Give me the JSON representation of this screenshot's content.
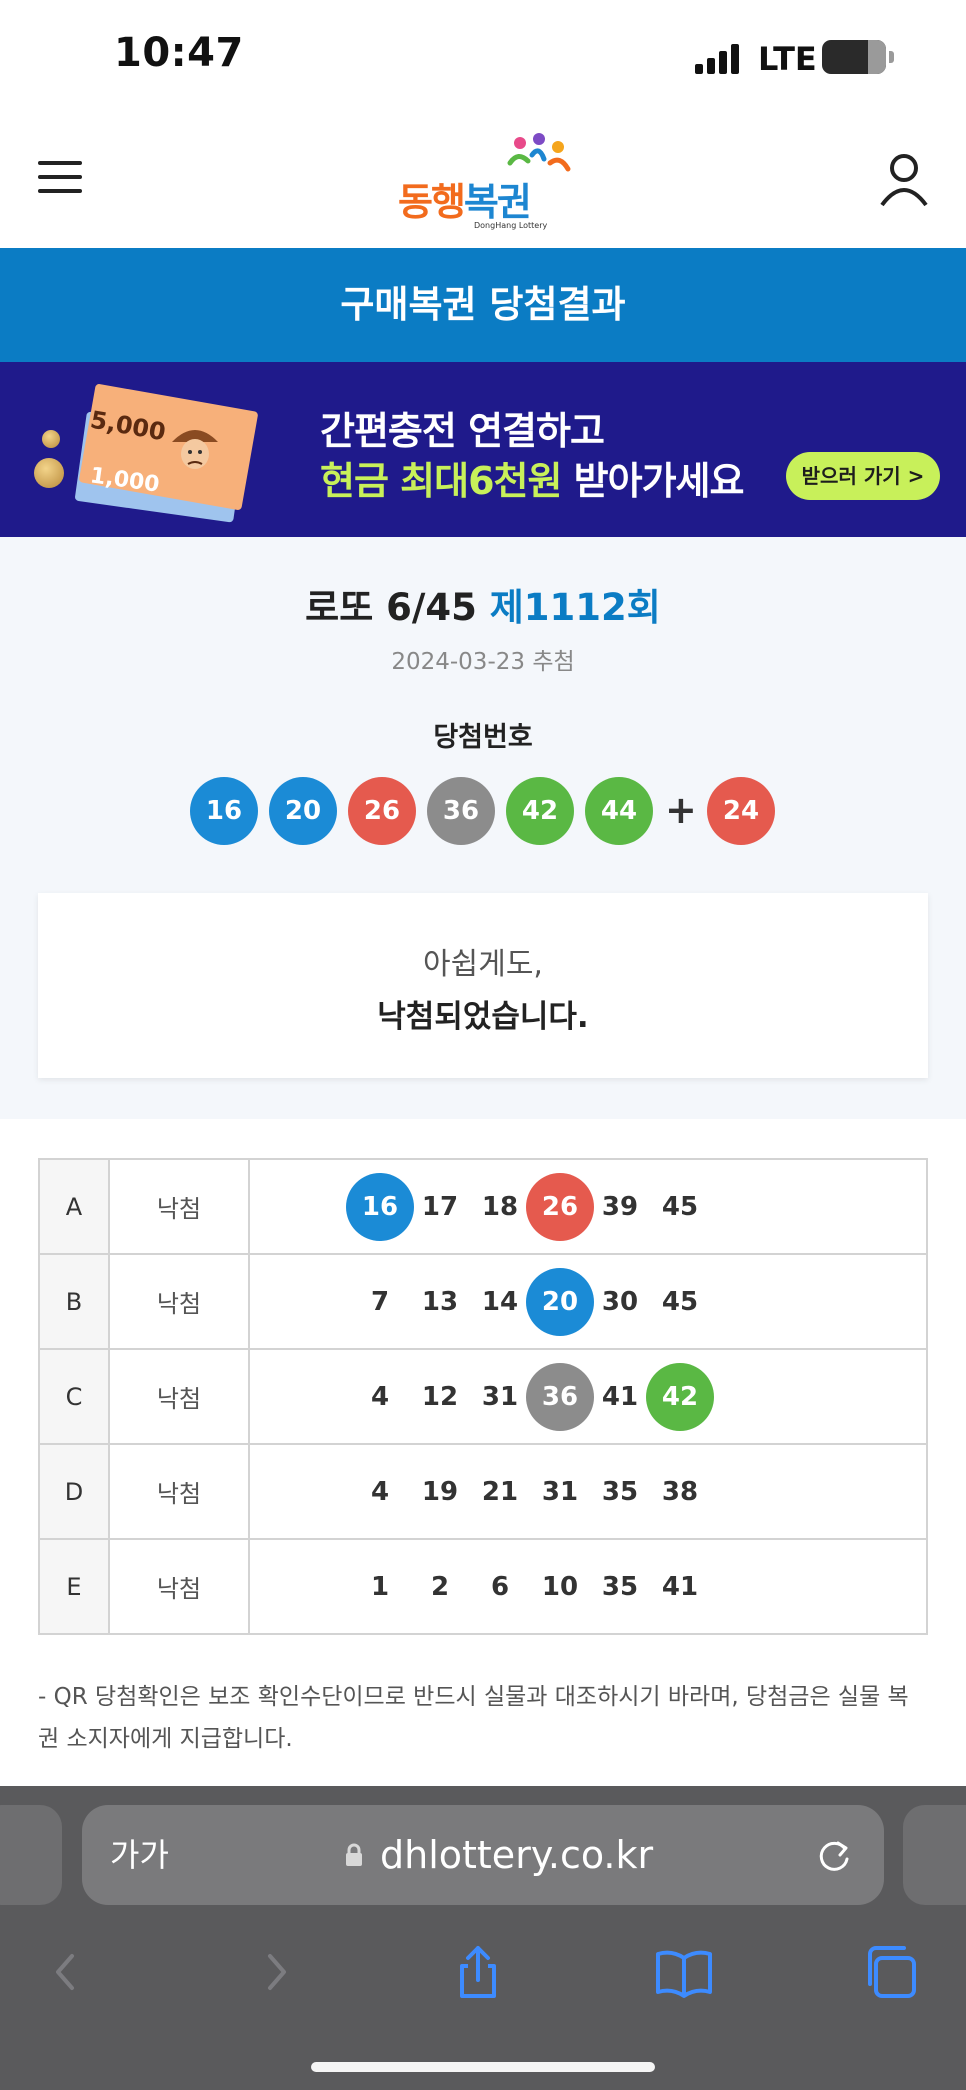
{
  "status_bar": {
    "time": "10:47",
    "network": "LTE",
    "battery": "64"
  },
  "header": {
    "logo_part1": "동행",
    "logo_part2": "복권",
    "logo_sub": "DongHang Lottery",
    "menu_icon": "hamburger-menu-icon",
    "user_icon": "user-icon"
  },
  "page_title": "구매복권 당첨결과",
  "banner": {
    "bill1_amount": "5,000",
    "bill2_amount": "1,000",
    "line1": "간편충전 연결하고",
    "line2_highlight": "현금 최대6천원",
    "line2_rest": " 받아가세요",
    "cta_label": "받으러 가기 >"
  },
  "draw": {
    "game": "로또 6/45",
    "round": "제1112회",
    "date": "2024-03-23 추첨",
    "label": "당첨번호",
    "numbers": [
      "16",
      "20",
      "26",
      "36",
      "42",
      "44"
    ],
    "plus": "+",
    "bonus": "24",
    "colors": {
      "blue": "#1b8bd6",
      "red": "#e55a4e",
      "gray": "#8c8c8c",
      "green": "#5ab844"
    }
  },
  "message": {
    "line1": "아쉽게도,",
    "line2": "낙첨되었습니다."
  },
  "tickets": [
    {
      "id": "A",
      "result": "낙첨",
      "numbers": [
        "16",
        "17",
        "18",
        "26",
        "39",
        "45"
      ]
    },
    {
      "id": "B",
      "result": "낙첨",
      "numbers": [
        "7",
        "13",
        "14",
        "20",
        "30",
        "45"
      ]
    },
    {
      "id": "C",
      "result": "낙첨",
      "numbers": [
        "4",
        "12",
        "31",
        "36",
        "41",
        "42"
      ]
    },
    {
      "id": "D",
      "result": "낙첨",
      "numbers": [
        "4",
        "19",
        "21",
        "31",
        "35",
        "38"
      ]
    },
    {
      "id": "E",
      "result": "낙첨",
      "numbers": [
        "1",
        "2",
        "6",
        "10",
        "35",
        "41"
      ]
    }
  ],
  "note": "- QR 당첨확인은 보조 확인수단이므로 반드시 실물과 대조하시기 바라며, 당첨금은 실물 복권 소지자에게 지급합니다.",
  "browser": {
    "text_size_label": "가가",
    "url": "dhlottery.co.kr",
    "icons": [
      "lock-icon",
      "reload-icon",
      "back-icon",
      "forward-icon",
      "share-icon",
      "bookmarks-icon",
      "tabs-icon"
    ]
  }
}
